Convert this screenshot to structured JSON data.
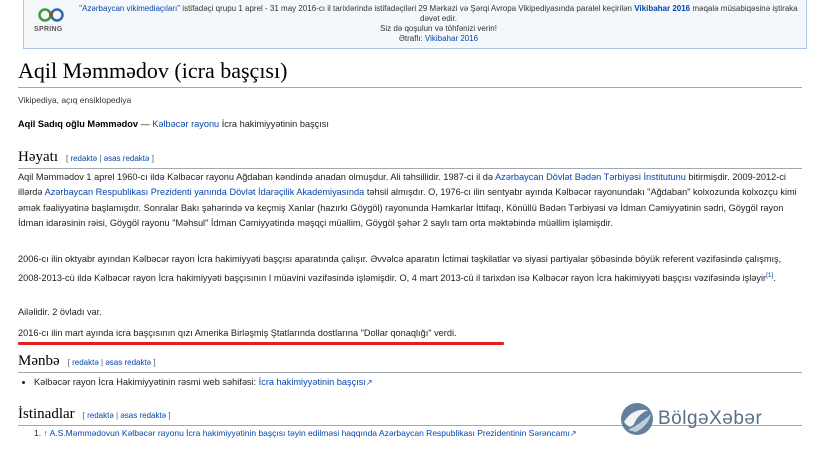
{
  "banner": {
    "line1_a": "\"Azərbaycan vikimediaçıları\"",
    "line1_b": " istifadəçi qrupu 1 aprel - 31 may 2016-cı il tarixlərində istifadəçiləri 29 Mərkəzi və Şərqi Avropa Vikipediyasında paralel keçirilən ",
    "line1_c": "Vikibahar 2016",
    "line1_d": " məqalə müsabiqəsinə iştiraka dəvət edir.",
    "line2": "Siz də qoşulun və töhfənizi verin!",
    "line3_a": "Ətraflı:",
    "line3_b": " Vikibahar 2016",
    "logo_text": "SPRING"
  },
  "page": {
    "title": "Aqil Məmmədov (icra başçısı)",
    "tagline": "Vikipediya, açıq ensiklopediya"
  },
  "lead": {
    "bold": "Aqil Sadıq oğlu Məmmədov",
    "dash": " — ",
    "link1": "Kəlbəcər rayonu",
    "rest": " İcra hakimiyyətinin başçısı"
  },
  "sections": {
    "heyati": {
      "title": "Həyatı",
      "edit_open": "[ ",
      "edit1": "redaktə",
      "sep": " | ",
      "edit2": "əsas redaktə",
      "edit_close": " ]"
    },
    "menbe": {
      "title": "Mənbə",
      "edit_open": "[ ",
      "edit1": "redaktə",
      "sep": " | ",
      "edit2": "əsas redaktə",
      "edit_close": " ]"
    },
    "istinadlar": {
      "title": "İstinadlar",
      "edit_open": "[ ",
      "edit1": "redaktə",
      "sep": " | ",
      "edit2": "əsas redaktə",
      "edit_close": " ]"
    }
  },
  "bio": {
    "p1_a": "Aqil Məmmədov 1 aprel 1960-cı ildə Kəlbəcər rayonu Ağdaban kəndində anadan olmuşdur. Ali təhsillidir. 1987-ci il də ",
    "p1_link1": "Azərbaycan Dövlət Bədən Tərbiyəsi İnstitutunu",
    "p1_b": " bitirmişdir. 2009-2012-ci illərdə ",
    "p1_link2": "Azərbaycan Respublikası Prezidenti yanında Dövlət İdarəçilik Akademiyasında",
    "p1_c": " təhsil almışdır. O, 1976-cı ilin sentyabr ayında Kəlbəcər rayonundakı \"Ağdaban\" kolxozunda kolxozçu kimi əmək fəaliyyətinə başlamışdır. Sonralar Bakı şəhərində və keçmiş Xanlar (hazırkı Göygöl) rayonunda Həmkarlar İttifaqı, Könüllü Bədən Tərbiyəsi və İdman Cəmiyyətinin sədri, Göygöl rayon İdman idarəsinin rəisi, Göygöl rayonu \"Məhsul\" İdman Cəmiyyətində məşqçi müəllim, Göygöl şəhər 2 saylı tam orta məktəbində müəllim işləmişdir.",
    "p2": "2006-cı ilin oktyabr ayından Kəlbəcər rayon İcra hakimiyyəti başçısı aparatında çalışır. Əvvəlcə aparatın İctimai təşkilatlar və siyasi partiyalar şöbəsində böyük referent vəzifəsində çalışmış, 2008-2013-cü ildə Kəlbəcər rayon İcra hakimiyyəti başçısının I müavini vəzifəsində işləmişdir. O, 4 mart 2013-cü il tarixdən isə Kəlbəcər rayon İcra hakimiyyəti başçısı vəzifəsində işləyir",
    "p2_ref": "[1]",
    "p2_end": ".",
    "p3": "Ailəlidir. 2 övladı var.",
    "p4": "2016-cı ilin mart ayında icra başçısının qızı Amerika Birləşmiş Ştatlarında dostlarına \"Dollar qonaqlığı\" verdi."
  },
  "sources": {
    "item1_text": "Kəlbəcər rayon İcra Hakimiyyətinin rəsmi web səhifəsi: ",
    "item1_link": "İcra hakimiyyətinin başçısı"
  },
  "references": {
    "item1_num": "1.",
    "item1_arrow": "↑",
    "item1_link": "A.S.Məmmədovun Kəlbəcər rayonu İcra hakimiyyətinin başçısı təyin edilməsi haqqında Azərbaycan Respublikası Prezidentinin Sərəncamı"
  },
  "watermark": {
    "text": "BölgəXəbər"
  },
  "colors": {
    "link": "#0645ad",
    "highlight": "#e02020",
    "banner_border": "#a7c6e6"
  }
}
